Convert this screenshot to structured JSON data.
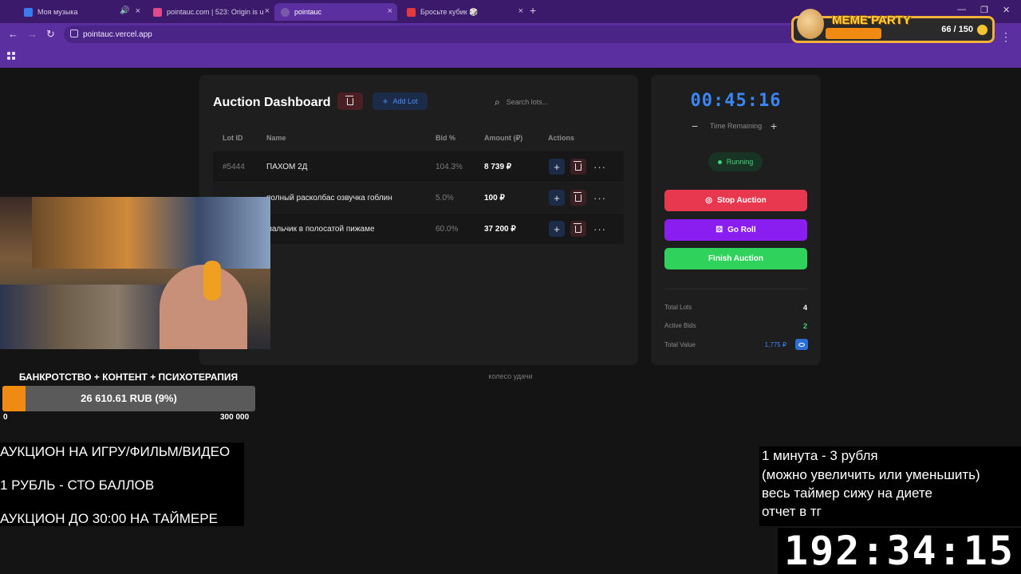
{
  "browser": {
    "tabs": [
      {
        "label": "Моя музыка",
        "active": false
      },
      {
        "label": "pointauc.com | 523: Origin is u",
        "active": false
      },
      {
        "label": "pointauc",
        "active": true
      },
      {
        "label": "Бросьте кубик 🎲",
        "active": false
      }
    ],
    "url": "pointauc.vercel.app"
  },
  "meme_party": {
    "title": "MEME PARTY",
    "count": "66 / 150",
    "progress": 0.44
  },
  "dashboard": {
    "title": "Auction Dashboard",
    "add_lot_label": "Add Lot",
    "search_placeholder": "Search lots...",
    "columns": [
      "Lot ID",
      "Name",
      "Bid %",
      "Amount (₽)",
      "Actions"
    ],
    "rows": [
      {
        "lot_id": "#5444",
        "name": "ПАХОМ 2Д",
        "bid": "104.3%",
        "amount": "8 739 ₽"
      },
      {
        "lot_id": "",
        "name": "полный расколбас озвучка гоблин",
        "bid": "5.0%",
        "amount": "100 ₽"
      },
      {
        "lot_id": "",
        "name": "мальчик в полосатой пижаме",
        "bid": "60.0%",
        "amount": "37 200 ₽"
      }
    ],
    "caption": "колесо удачи"
  },
  "timer_panel": {
    "clock": "00:45:16",
    "clock_label": "Time Remaining",
    "status": "Running",
    "stop_label": "Stop Auction",
    "roll_label": "Go Roll",
    "finish_label": "Finish Auction",
    "stats": [
      {
        "label": "Total Lots",
        "value": "4"
      },
      {
        "label": "Active Bids",
        "value": "2"
      },
      {
        "label": "Total Value",
        "value": "1,775 ₽"
      }
    ],
    "colors": {
      "stop": "#e8384f",
      "roll": "#8a1df0",
      "finish": "#2fd25a",
      "accent": "#3a86f5"
    }
  },
  "goal": {
    "title": "БАНКРОТСТВО + КОНТЕНТ + ПСИХОТЕРАПИЯ",
    "text": "26 610.61 RUB (9%)",
    "progress": 0.09,
    "min": "0",
    "max": "300 000"
  },
  "info_left": [
    "АУКЦИОН НА ИГРУ/ФИЛЬМ/ВИДЕО",
    "1 РУБЛЬ - СТО БАЛЛОВ",
    "АУКЦИОН ДО 30:00 НА ТАЙМЕРЕ"
  ],
  "info_right": [
    "1 минута - 3 рубля",
    "(можно увеличить или уменьшить)",
    "весь таймер сижу на диете",
    "отчет в тг"
  ],
  "big_timer": "192:34:15"
}
